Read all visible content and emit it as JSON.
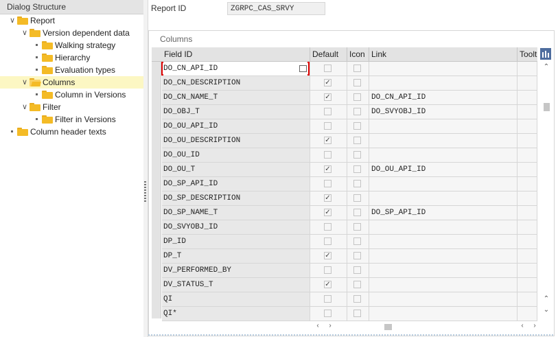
{
  "dialog_structure": {
    "title": "Dialog Structure",
    "items": [
      {
        "label": "Report",
        "level": 0,
        "type": "expanded",
        "selected": false
      },
      {
        "label": "Version dependent data",
        "level": 1,
        "type": "expanded",
        "selected": false
      },
      {
        "label": "Walking strategy",
        "level": 2,
        "type": "leaf",
        "selected": false
      },
      {
        "label": "Hierarchy",
        "level": 2,
        "type": "leaf",
        "selected": false
      },
      {
        "label": "Evaluation types",
        "level": 2,
        "type": "leaf",
        "selected": false
      },
      {
        "label": "Columns",
        "level": 1,
        "type": "expanded",
        "selected": true
      },
      {
        "label": "Column in Versions",
        "level": 2,
        "type": "leaf",
        "selected": false
      },
      {
        "label": "Filter",
        "level": 1,
        "type": "expanded",
        "selected": false
      },
      {
        "label": "Filter in Versions",
        "level": 2,
        "type": "leaf",
        "selected": false
      },
      {
        "label": "Column header texts",
        "level": 0,
        "type": "leaf",
        "selected": false
      }
    ]
  },
  "report": {
    "label": "Report ID",
    "value": "ZGRPC_CAS_SRVY"
  },
  "columns_table": {
    "title": "Columns",
    "headers": {
      "field_id": "Field ID",
      "default": "Default",
      "icon": "Icon",
      "link": "Link",
      "tooltip": "Toolt"
    },
    "rows": [
      {
        "field_id": "DO_CN_API_ID",
        "default": false,
        "icon": false,
        "link": ""
      },
      {
        "field_id": "DO_CN_DESCRIPTION",
        "default": true,
        "icon": false,
        "link": ""
      },
      {
        "field_id": "DO_CN_NAME_T",
        "default": true,
        "icon": false,
        "link": "DO_CN_API_ID"
      },
      {
        "field_id": "DO_OBJ_T",
        "default": false,
        "icon": false,
        "link": "DO_SVYOBJ_ID"
      },
      {
        "field_id": "DO_OU_API_ID",
        "default": false,
        "icon": false,
        "link": ""
      },
      {
        "field_id": "DO_OU_DESCRIPTION",
        "default": true,
        "icon": false,
        "link": ""
      },
      {
        "field_id": "DO_OU_ID",
        "default": false,
        "icon": false,
        "link": ""
      },
      {
        "field_id": "DO_OU_T",
        "default": true,
        "icon": false,
        "link": "DO_OU_API_ID"
      },
      {
        "field_id": "DO_SP_API_ID",
        "default": false,
        "icon": false,
        "link": ""
      },
      {
        "field_id": "DO_SP_DESCRIPTION",
        "default": true,
        "icon": false,
        "link": ""
      },
      {
        "field_id": "DO_SP_NAME_T",
        "default": true,
        "icon": false,
        "link": "DO_SP_API_ID"
      },
      {
        "field_id": "DO_SVYOBJ_ID",
        "default": false,
        "icon": false,
        "link": ""
      },
      {
        "field_id": "DP_ID",
        "default": false,
        "icon": false,
        "link": ""
      },
      {
        "field_id": "DP_T",
        "default": true,
        "icon": false,
        "link": ""
      },
      {
        "field_id": "DV_PERFORMED_BY",
        "default": false,
        "icon": false,
        "link": ""
      },
      {
        "field_id": "DV_STATUS_T",
        "default": true,
        "icon": false,
        "link": ""
      },
      {
        "field_id": "QI",
        "default": false,
        "icon": false,
        "link": ""
      },
      {
        "field_id": "QI*",
        "default": false,
        "icon": false,
        "link": ""
      }
    ]
  }
}
